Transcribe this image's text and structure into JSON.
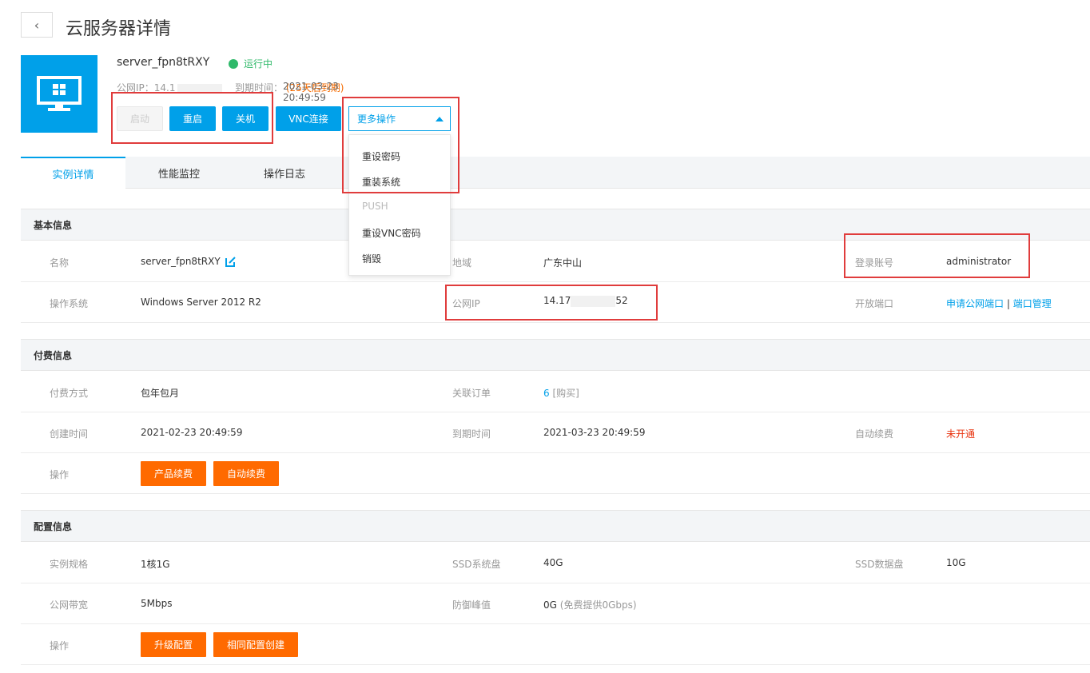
{
  "header": {
    "back_icon": "chevron-left-icon",
    "title": "云服务器详情"
  },
  "server": {
    "name": "server_fpn8tRXY",
    "status": "运行中",
    "ip_prefix": "公网IP：14.1",
    "expire_label": "到期时间：",
    "expire_value": "2021-03-23 20:49:59",
    "expire_warn": "(25天后到期)"
  },
  "actions": {
    "start": "启动",
    "restart": "重启",
    "shutdown": "关机",
    "vnc": "VNC连接",
    "more": "更多操作"
  },
  "dropdown": {
    "items": [
      "重设密码",
      "重装系统",
      "PUSH",
      "重设VNC密码",
      "销毁"
    ]
  },
  "tabs": [
    "实例详情",
    "性能监控",
    "操作日志"
  ],
  "basic": {
    "section": "基本信息",
    "name_label": "名称",
    "name_value": "server_fpn8tRXY",
    "region_label": "地域",
    "region_value": "广东中山",
    "login_label": "登录账号",
    "login_value": "administrator",
    "os_label": "操作系统",
    "os_value": "Windows Server 2012 R2",
    "ip_label": "公网IP",
    "ip_start": "14.17",
    "ip_end": "52",
    "ports_label": "开放端口",
    "ports_apply": "申请公网端口",
    "ports_sep": "|",
    "ports_manage": "端口管理"
  },
  "billing": {
    "section": "付费信息",
    "pay_label": "付费方式",
    "pay_value": "包年包月",
    "order_label": "关联订单",
    "order_value": "6",
    "order_suffix": "[购买]",
    "created_label": "创建时间",
    "created_value": "2021-02-23 20:49:59",
    "expire_label": "到期时间",
    "expire_value": "2021-03-23 20:49:59",
    "auto_label": "自动续费",
    "auto_value": "未开通",
    "op_label": "操作",
    "renew_btn": "产品续费",
    "auto_btn": "自动续费"
  },
  "config": {
    "section": "配置信息",
    "spec_label": "实例规格",
    "spec_value": "1核1G",
    "sysdisk_label": "SSD系统盘",
    "sysdisk_value": "40G",
    "datadisk_label": "SSD数据盘",
    "datadisk_value": "10G",
    "bw_label": "公网带宽",
    "bw_value": "5Mbps",
    "ddos_label": "防御峰值",
    "ddos_value": "0G",
    "ddos_note": "(免费提供0Gbps)",
    "op_label": "操作",
    "upgrade_btn": "升级配置",
    "clone_btn": "相同配置创建"
  },
  "colors": {
    "primary": "#00a0e9",
    "orange": "#ff6a00",
    "success": "#2fb96a",
    "danger": "#e8320e",
    "annotation": "#e03c3c"
  }
}
